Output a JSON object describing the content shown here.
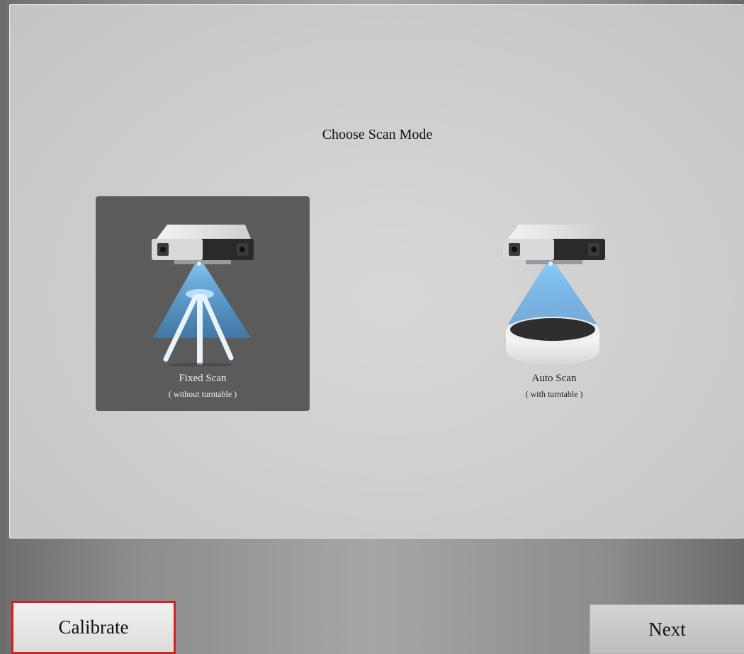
{
  "title": "Choose Scan Mode",
  "modes": [
    {
      "name": "Fixed Scan",
      "sub": "( without turntable )",
      "icon": "scanner-tripod-icon",
      "selected": true
    },
    {
      "name": "Auto Scan",
      "sub": "( with turntable )",
      "icon": "scanner-turntable-icon",
      "selected": false
    }
  ],
  "buttons": {
    "calibrate": "Calibrate",
    "next": "Next"
  },
  "colors": {
    "selected_card": "#5b5b5b",
    "calibrate_border": "#d42020",
    "beam": "#2f8fe0"
  }
}
